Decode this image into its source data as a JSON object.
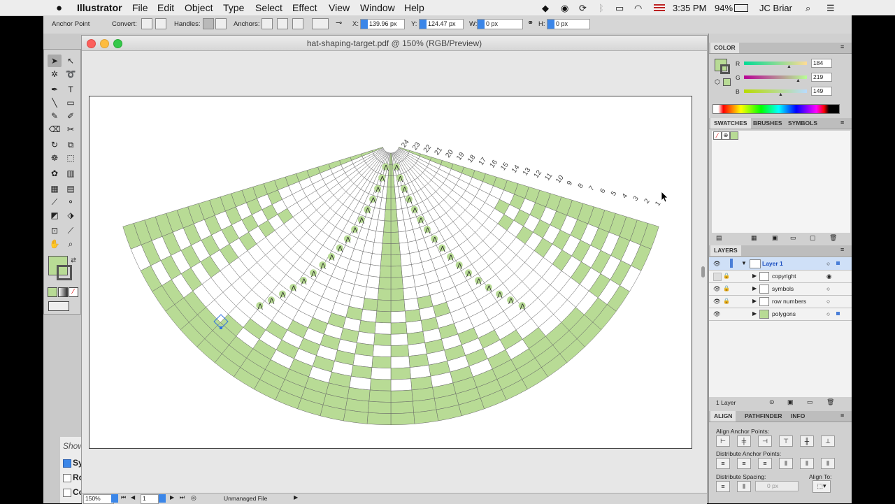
{
  "menubar": {
    "apple": "",
    "app": "Illustrator",
    "items": [
      "File",
      "Edit",
      "Object",
      "Type",
      "Select",
      "Effect",
      "View",
      "Window",
      "Help"
    ],
    "time": "3:35 PM",
    "battery": "94%",
    "user": "JC Briar"
  },
  "controlbar": {
    "anchor_point": "Anchor Point",
    "convert": "Convert:",
    "handles": "Handles:",
    "anchors": "Anchors:",
    "x_label": "X:",
    "x_value": "139.96 px",
    "y_label": "Y:",
    "y_value": "124.47 px",
    "w_label": "W:",
    "w_value": "0 px",
    "h_label": "H:",
    "h_value": "0 px"
  },
  "document": {
    "title": "hat-shaping-target.pdf @ 150% (RGB/Preview)",
    "zoom": "150%",
    "page": "1",
    "file_status": "Unmanaged File"
  },
  "chart_labels": {
    "row_numbers": [
      "1",
      "2",
      "3",
      "4",
      "5",
      "6",
      "7",
      "8",
      "9",
      "10",
      "11",
      "12",
      "13",
      "14",
      "15",
      "16",
      "17",
      "18",
      "19",
      "20",
      "21",
      "22",
      "23",
      "24"
    ]
  },
  "left_peek": {
    "show": "Show",
    "items": [
      "Sy",
      "Ro",
      "Co"
    ]
  },
  "color_panel": {
    "title": "COLOR",
    "r_label": "R",
    "r_value": "184",
    "g_label": "G",
    "g_value": "219",
    "b_label": "B",
    "b_value": "149",
    "fill_color": "#b8db95"
  },
  "swatches_panel": {
    "tabs": [
      "SWATCHES",
      "BRUSHES",
      "SYMBOLS"
    ]
  },
  "layers_panel": {
    "title": "LAYERS",
    "layer": "Layer 1",
    "sublayers": [
      "copyright",
      "symbols",
      "row numbers",
      "polygons"
    ],
    "count": "1 Layer"
  },
  "align_panel": {
    "tabs": [
      "ALIGN",
      "PATHFINDER",
      "INFO"
    ],
    "align_anchor_points": "Align Anchor Points:",
    "distribute_anchor_points": "Distribute Anchor Points:",
    "distribute_spacing": "Distribute Spacing:",
    "align_to": "Align To:",
    "spacing_value": "0 px"
  },
  "colors": {
    "green": "#b8db95",
    "grid_line": "#666666",
    "selection": "#2f6fe0"
  }
}
